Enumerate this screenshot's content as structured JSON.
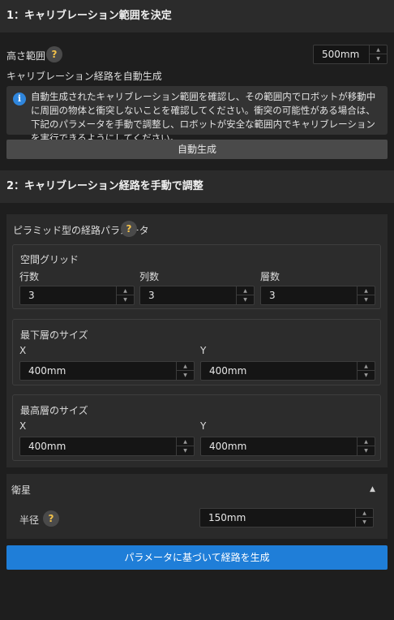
{
  "section1": {
    "title": "1：キャリブレーション範囲を決定",
    "height_label": "高さ範囲",
    "height_value": "500mm",
    "auto_label": "キャリブレーション経路を自動生成",
    "info_text": "自動生成されたキャリブレーション範囲を確認し、その範囲内でロボットが移動中に周囲の物体と衝突しないことを確認してください。衝突の可能性がある場合は、下記のパラメータを手動で調整し、ロボットが安全な範囲内でキャリブレーションを実行できるようにしてください。",
    "auto_button": "自動生成"
  },
  "section2": {
    "title": "2：キャリブレーション経路を手動で調整",
    "pyramid_label": "ピラミッド型の経路パラメータ",
    "grid": {
      "title": "空間グリッド",
      "rows_label": "行数",
      "rows_value": "3",
      "cols_label": "列数",
      "cols_value": "3",
      "layers_label": "層数",
      "layers_value": "3"
    },
    "bottom": {
      "title": "最下層のサイズ",
      "x_label": "X",
      "x_value": "400mm",
      "y_label": "Y",
      "y_value": "400mm"
    },
    "top": {
      "title": "最高層のサイズ",
      "x_label": "X",
      "x_value": "400mm",
      "y_label": "Y",
      "y_value": "400mm"
    },
    "satellite": {
      "title": "衛星",
      "radius_label": "半径",
      "radius_value": "150mm"
    },
    "generate_button": "パラメータに基づいて経路を生成"
  },
  "icons": {
    "help": "?",
    "info": "i",
    "up": "▲",
    "down": "▼",
    "collapse": "▲"
  },
  "colors": {
    "accent": "#1f7ed8",
    "help": "#f3c24a"
  }
}
